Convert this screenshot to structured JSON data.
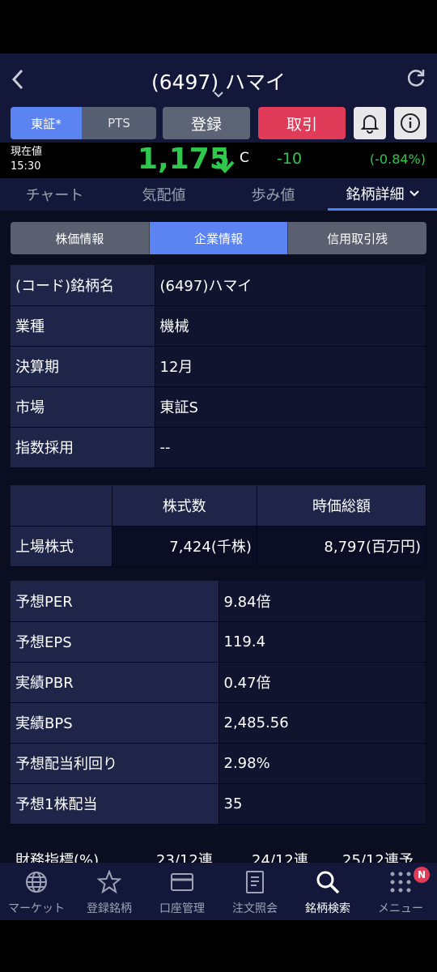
{
  "header": {
    "title": "(6497) ハマイ"
  },
  "toolbar": {
    "market_tse": "東証*",
    "market_pts": "PTS",
    "register": "登録",
    "trade": "取引"
  },
  "price": {
    "label_line1": "現在値",
    "label_line2": "15:30",
    "value": "1,175",
    "flag": "C",
    "change": "-10",
    "change_pct": "(-0.84%)",
    "color_down": "#2ec84c"
  },
  "tabs": [
    "チャート",
    "気配値",
    "歩み値",
    "銘柄詳細"
  ],
  "subtabs": [
    "株価情報",
    "企業情報",
    "信用取引残"
  ],
  "company": [
    {
      "key": "(コード)銘柄名",
      "value": "(6497)ハマイ"
    },
    {
      "key": "業種",
      "value": "機械"
    },
    {
      "key": "決算期",
      "value": "12月"
    },
    {
      "key": "市場",
      "value": "東証S"
    },
    {
      "key": "指数採用",
      "value": "--"
    }
  ],
  "shares": {
    "col1": "株式数",
    "col2": "時価総額",
    "row_label": "上場株式",
    "count": "7,424(千株)",
    "market_cap": "8,797(百万円)"
  },
  "ratios": [
    {
      "key": "予想PER",
      "value": "9.84倍"
    },
    {
      "key": "予想EPS",
      "value": "119.4"
    },
    {
      "key": "実績PBR",
      "value": "0.47倍"
    },
    {
      "key": "実績BPS",
      "value": "2,485.56"
    },
    {
      "key": "予想配当利回り",
      "value": "2.98%"
    },
    {
      "key": "予想1株配当",
      "value": "35"
    }
  ],
  "financial_header": {
    "label": "財務指標(%)",
    "col1": "23/12連",
    "col2": "24/12連",
    "col3": "25/12連予"
  },
  "bottom_nav": [
    {
      "label": "マーケット",
      "icon": "globe-icon"
    },
    {
      "label": "登録銘柄",
      "icon": "star-icon"
    },
    {
      "label": "口座管理",
      "icon": "card-icon"
    },
    {
      "label": "注文照会",
      "icon": "document-icon"
    },
    {
      "label": "銘柄検索",
      "icon": "search-icon"
    },
    {
      "label": "メニュー",
      "icon": "grid-icon",
      "badge": "N"
    }
  ],
  "colors": {
    "accent_blue": "#5b84f2",
    "trade_red": "#e13b5a",
    "header_bg": "#13183a"
  }
}
